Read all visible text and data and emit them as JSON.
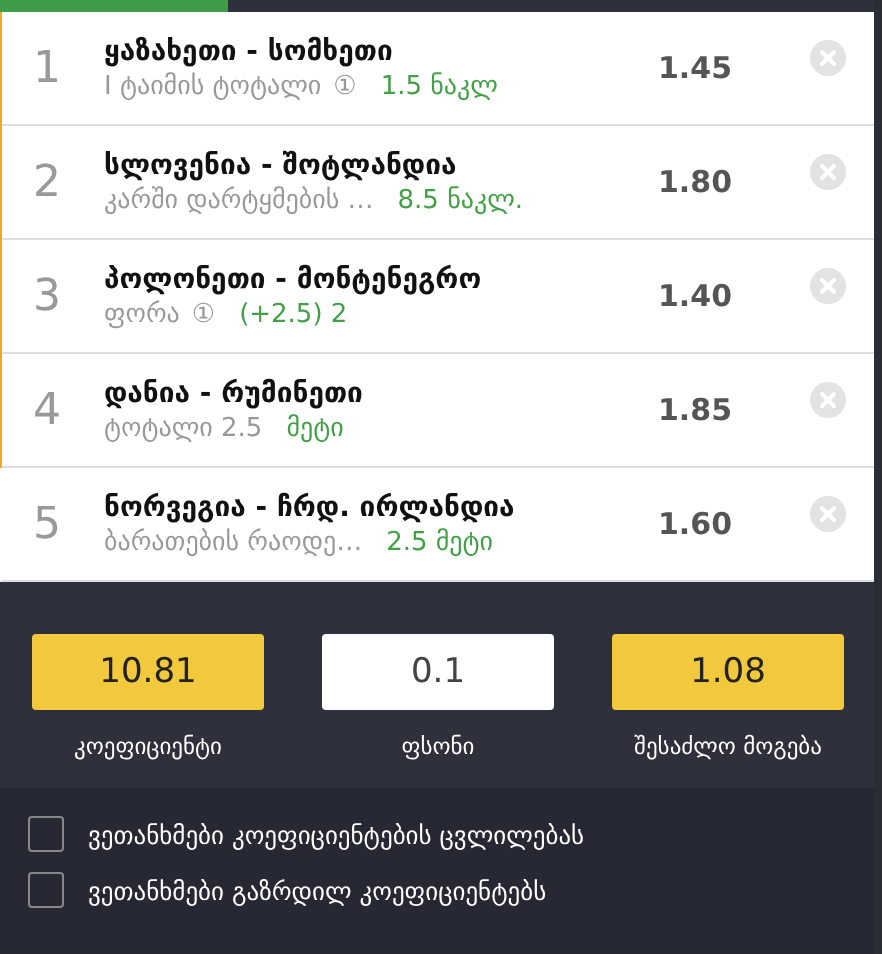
{
  "progress": {
    "level": 0.26
  },
  "bets": [
    {
      "number": "1",
      "match": "ყაზახეთი - სომხეთი",
      "market": "I ტაიმის ტოტალი",
      "info_mark": "①",
      "pick": "1.5 ნაკლ",
      "odds": "1.45"
    },
    {
      "number": "2",
      "match": "სლოვენია - შოტლანდია",
      "market": "კარში დარტყმების …",
      "pick": "8.5 ნაკლ.",
      "odds": "1.80"
    },
    {
      "number": "3",
      "match": "პოლონეთი - მონტენეგრო",
      "market": "ფორა",
      "info_mark": "①",
      "pick": "(+2.5) 2",
      "odds": "1.40"
    },
    {
      "number": "4",
      "match": "დანია - რუმინეთი",
      "market": "ტოტალი 2.5",
      "pick": "მეტი",
      "odds": "1.85"
    },
    {
      "number": "5",
      "match": "ნორვეგია - ჩრდ. ირლანდია",
      "market": "ბარათების რაოდე…",
      "pick": "2.5 მეტი",
      "odds": "1.60"
    }
  ],
  "summary": [
    {
      "kind": "display",
      "value": "10.81",
      "label": "კოეფიციენტი"
    },
    {
      "kind": "input",
      "value": "0.1",
      "label": "ფსონი"
    },
    {
      "kind": "display",
      "value": "1.08",
      "label": "შესაძლო მოგება"
    }
  ],
  "options": [
    {
      "label": "ვეთანხმები კოეფიციენტების ცვლილებას",
      "checked": false
    },
    {
      "label": "ვეთანხმები გაზრდილ კოეფიციენტებს",
      "checked": false
    }
  ]
}
